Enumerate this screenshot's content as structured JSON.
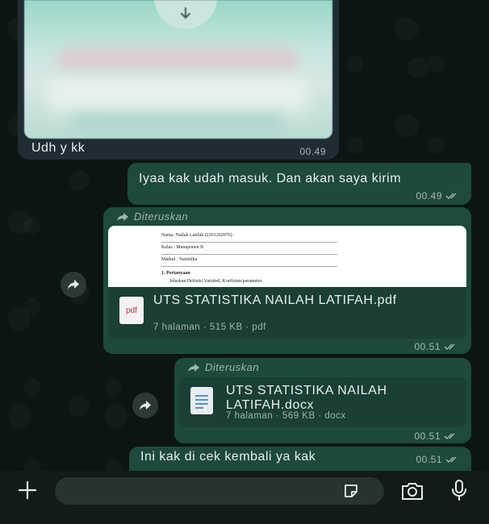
{
  "incoming": {
    "caption": "Udh y kk",
    "time": "00.49"
  },
  "outgoing": [
    {
      "text": "Iyaa kak udah masuk. Dan akan saya kirim",
      "time": "00.49"
    },
    {
      "forwarded_label": "Diteruskan",
      "preview_lines": [
        "Nama: Nailah Latifah (2261202076)",
        "Kelas : Manajemen B",
        "Matkul : Statistika",
        "1.    Pertanyaan",
        "Jelaskan Definisi Variabel, Koefisien/parameter"
      ],
      "file_icon_text": "pdf",
      "file_name": "UTS STATISTIKA NAILAH LATIFAH.pdf",
      "file_info": "7 halaman · 515 KB · pdf",
      "time": "00.51"
    },
    {
      "forwarded_label": "Diteruskan",
      "file_name": "UTS STATISTIKA NAILAH LATIFAH.docx",
      "file_info": "7 halaman · 569 KB · docx",
      "time": "00.51"
    },
    {
      "text": "Ini kak di cek kembali ya kak",
      "time": "00.51"
    }
  ],
  "input": {
    "value": ""
  },
  "colors": {
    "outgoing_bubble": "#1d4a3d",
    "incoming_bubble": "#1f2c34",
    "read_ticks": "#a7b7b3"
  }
}
